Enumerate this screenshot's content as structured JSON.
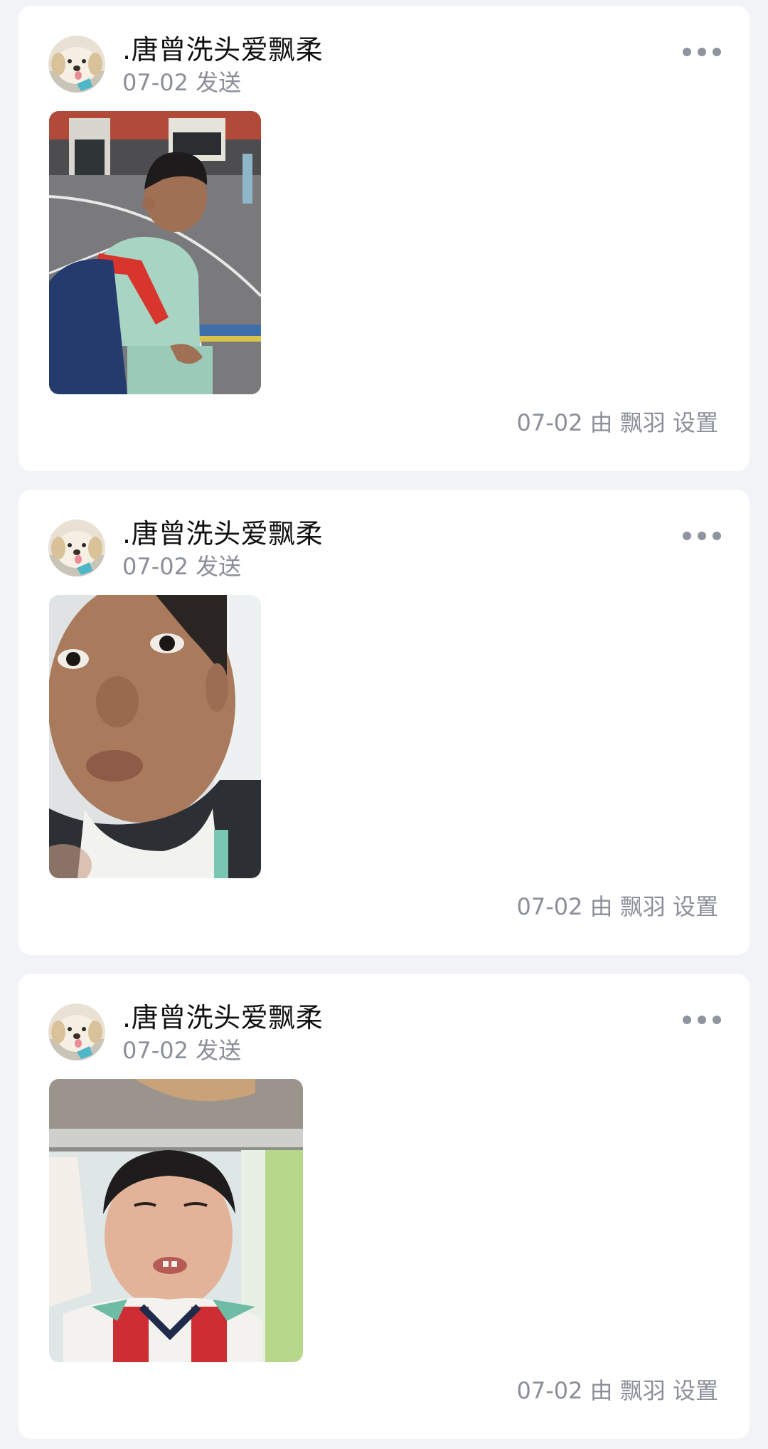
{
  "feed": {
    "posts": [
      {
        "author": ".唐曾洗头爱飘柔",
        "sent": "07-02 发送",
        "meta": "07-02 由 飘羽 设置",
        "photo": "boy-with-backpack-red-scarf-playground",
        "avatar": "puppy-avatar"
      },
      {
        "author": ".唐曾洗头爱飘柔",
        "sent": "07-02 发送",
        "meta": "07-02 由 飘羽 设置",
        "photo": "boy-closeup-pouting-face",
        "avatar": "puppy-avatar"
      },
      {
        "author": ".唐曾洗头爱飘柔",
        "sent": "07-02 发送",
        "meta": "07-02 由 飘羽 设置",
        "photo": "boy-peeking-under-desk",
        "avatar": "puppy-avatar"
      }
    ],
    "more_icon": "more-dots-icon"
  },
  "colors": {
    "background": "#f2f3f7",
    "card": "#ffffff",
    "name_text": "#111111",
    "secondary_text": "#8a8f99",
    "more_dots": "#8f949e"
  }
}
